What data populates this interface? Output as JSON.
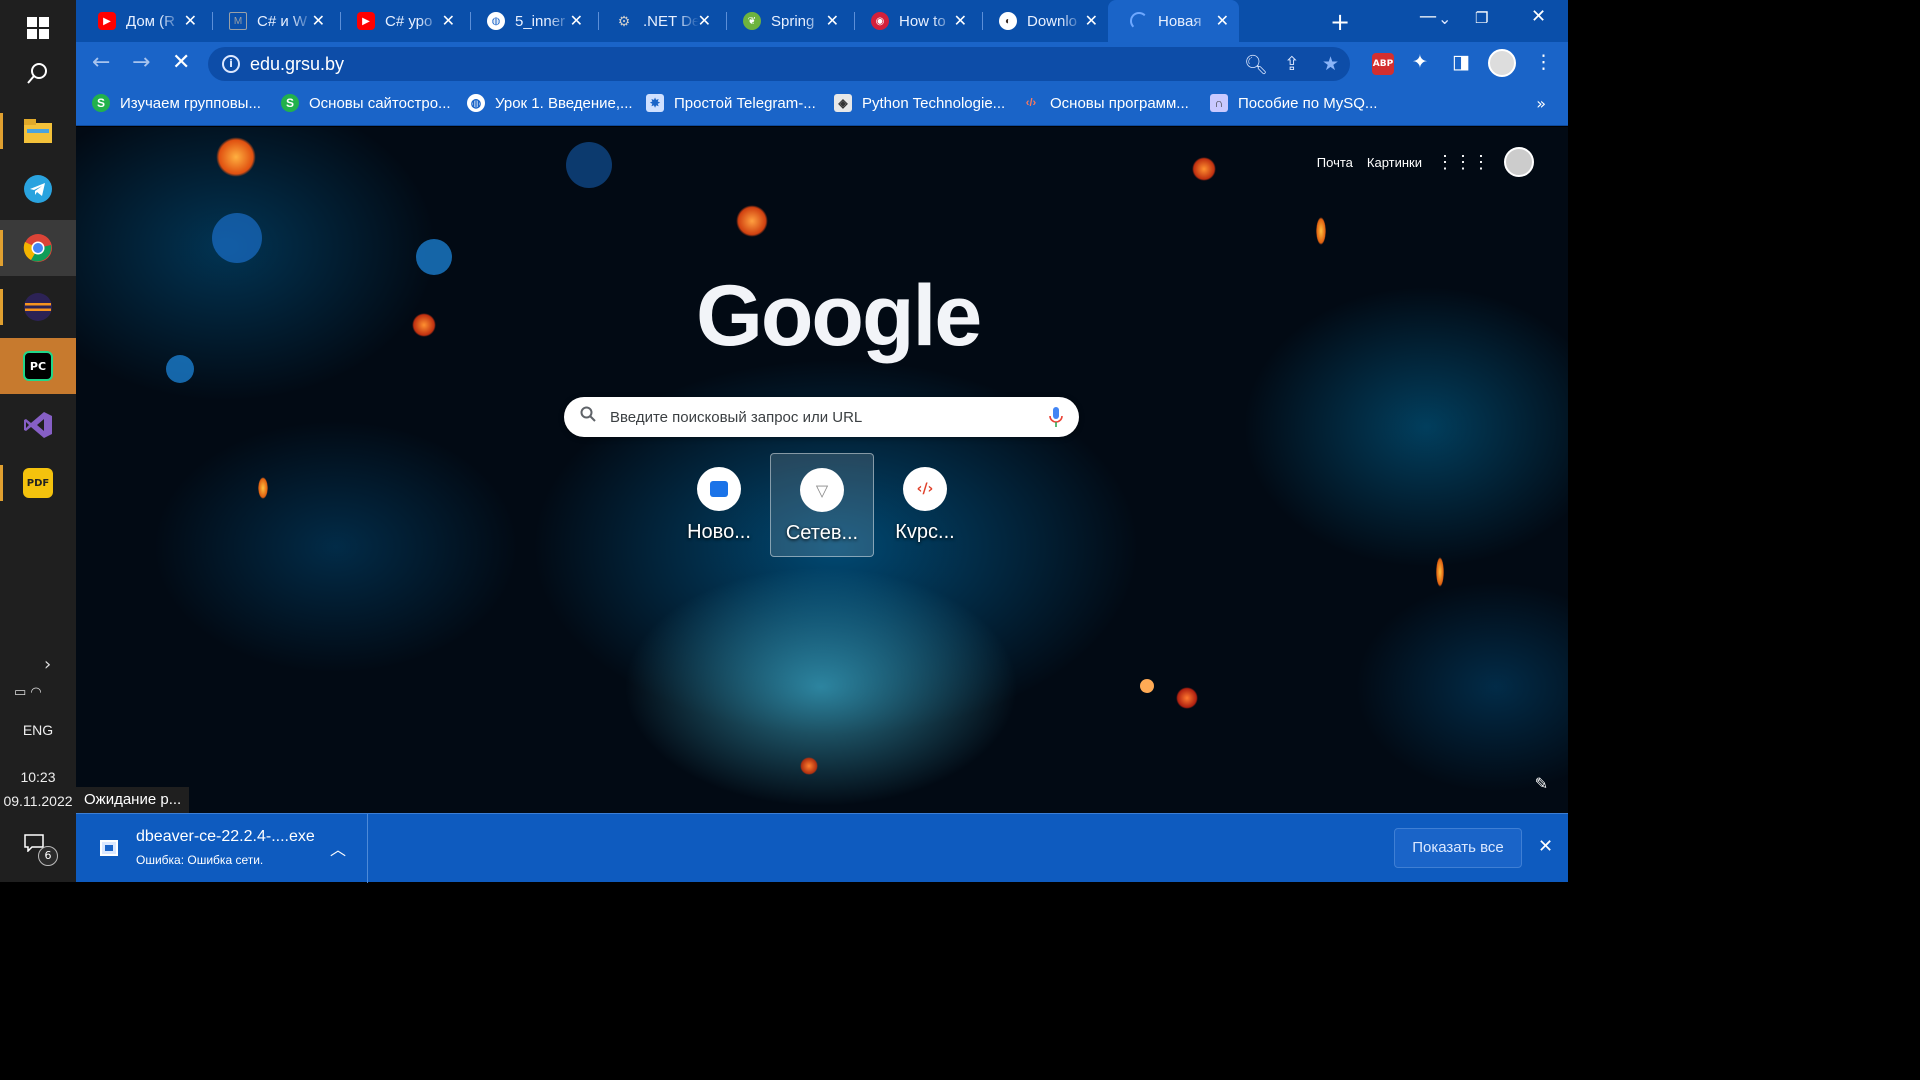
{
  "taskbar": {
    "pinned": [
      {
        "name": "windows-start-icon"
      },
      {
        "name": "search-icon"
      },
      {
        "name": "file-explorer-icon"
      },
      {
        "name": "telegram-icon"
      },
      {
        "name": "chrome-icon"
      },
      {
        "name": "eclipse-icon"
      },
      {
        "name": "pycharm-icon",
        "label": "PC"
      },
      {
        "name": "visual-studio-icon"
      },
      {
        "name": "pdf-reader-icon",
        "label": "PDF"
      }
    ],
    "language": "ENG",
    "time": "10:23",
    "date": "09.11.2022",
    "notification_count": "6"
  },
  "tabs": [
    {
      "title": "Дом (R",
      "favicon": "youtube-icon",
      "color": "#ff0000"
    },
    {
      "title": "C# и W",
      "favicon": "gmail-icon",
      "color": "#8a8a8a"
    },
    {
      "title": "C# уро",
      "favicon": "youtube-icon",
      "color": "#ff0000"
    },
    {
      "title": "5_inner",
      "favicon": "globe-icon",
      "color": "#ffffff"
    },
    {
      "title": ".NET De",
      "favicon": "dotnet-icon",
      "color": "#cccccc"
    },
    {
      "title": "Spring",
      "favicon": "spring-icon",
      "color": "#6db33f"
    },
    {
      "title": "How to",
      "favicon": "howto-icon",
      "color": "#d3203b"
    },
    {
      "title": "Downlo",
      "favicon": "dbeaver-icon",
      "color": "#ffffff"
    },
    {
      "title": "Новая",
      "favicon": "loading-icon",
      "color": "#6ea8ff",
      "active": true
    }
  ],
  "toolbar": {
    "url": "edu.grsu.by"
  },
  "bookmarks": [
    {
      "label": "Изучаем групповы...",
      "icon": "stepik-icon",
      "color": "#22b14c",
      "glyph": "S"
    },
    {
      "label": "Основы сайтостро...",
      "icon": "stepik-icon",
      "color": "#22b14c",
      "glyph": "S"
    },
    {
      "label": "Урок 1. Введение,...",
      "icon": "globe-icon",
      "color": "#ffffff",
      "glyph": "◍"
    },
    {
      "label": "Простой Telegram-...",
      "icon": "telegram-bot-icon",
      "color": "#7ab0ff",
      "glyph": "✸"
    },
    {
      "label": "Python Technologie...",
      "icon": "python-tech-icon",
      "color": "#e8e8e8",
      "glyph": "◈"
    },
    {
      "label": "Основы программ...",
      "icon": "code-icon",
      "color": "#e04e39",
      "glyph": "‹/›"
    },
    {
      "label": "Пособие по MySQ...",
      "icon": "mysql-icon",
      "color": "#8a8aff",
      "glyph": "∩"
    }
  ],
  "ntp": {
    "mail_link": "Почта",
    "images_link": "Картинки",
    "logo": "Google",
    "search_placeholder": "Введите поисковый запрос или URL",
    "shortcuts": [
      {
        "label": "Ново...",
        "icon": "messages-icon"
      },
      {
        "label": "Сетев...",
        "icon": "network-icon"
      },
      {
        "label": "Кvрс...",
        "icon": "code-icon"
      }
    ]
  },
  "status_text": "Ожидание р...",
  "download": {
    "filename": "dbeaver-ce-22.2.4-....exe",
    "status": "Ошибка: Ошибка сети.",
    "show_all": "Показать все"
  }
}
